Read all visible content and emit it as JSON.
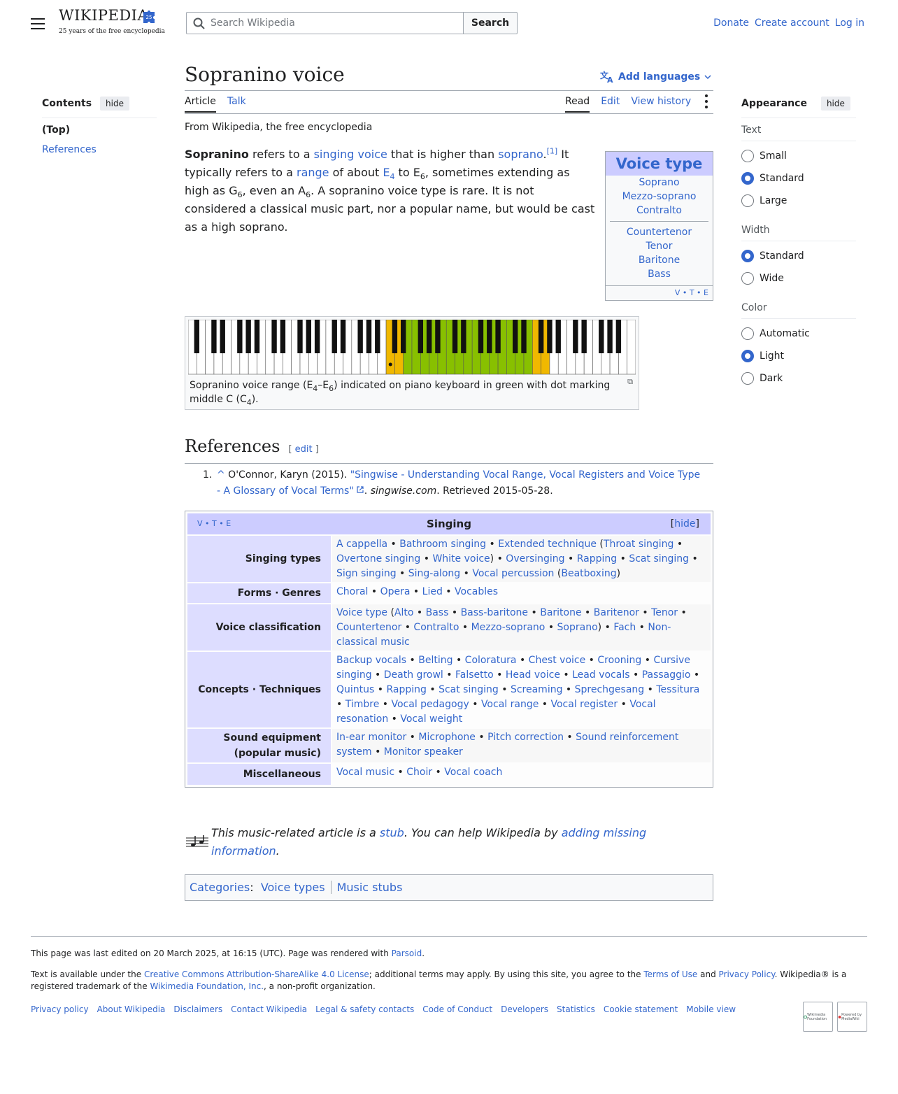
{
  "header": {
    "logo_word": "WIKIPEDIA",
    "logo_tagline": "25 years of the free encyclopedia",
    "search_placeholder": "Search Wikipedia",
    "search_button": "Search",
    "user_links": [
      "Donate",
      "Create account",
      "Log in"
    ]
  },
  "toc": {
    "title": "Contents",
    "hide": "hide",
    "items": [
      "(Top)",
      "References"
    ]
  },
  "page": {
    "title": "Sopranino voice",
    "add_languages": "Add languages",
    "tabs_left": [
      "Article",
      "Talk"
    ],
    "tabs_right": [
      "Read",
      "Edit",
      "View history"
    ],
    "from": "From Wikipedia, the free encyclopedia"
  },
  "lead": {
    "bold": "Sopranino",
    "t1": " refers to a ",
    "l1": "singing voice",
    "t2": " that is higher than ",
    "l2": "soprano",
    "t2b": ".",
    "cite": "[1]",
    "t3": " It typically refers to a ",
    "l3": "range",
    "t4": " of about ",
    "l4": "E",
    "l4sub": "4",
    "t5": " to E",
    "t5sub": "6",
    "t6": ", sometimes extending as high as G",
    "t6sub": "6",
    "t7": ", even an A",
    "t7sub": "6",
    "t8": ". A sopranino voice type is rare. It is not considered a classical music part, nor a popular name, but would be cast as a high soprano."
  },
  "voicebox": {
    "title": "Voice type",
    "female": [
      "Soprano",
      "Mezzo-soprano",
      "Contralto"
    ],
    "male": [
      "Countertenor",
      "Tenor",
      "Baritone",
      "Bass"
    ],
    "vte": "V • T • E"
  },
  "piano": {
    "caption_a": "Sopranino voice range (E",
    "caption_sub1": "4",
    "caption_b": "–E",
    "caption_sub2": "6",
    "caption_c": ") indicated on piano keyboard in green with dot marking middle C (C",
    "caption_sub3": "4",
    "caption_d": ").",
    "range_color": "#88c000",
    "extension_color": "#f0b800"
  },
  "references": {
    "heading": "References",
    "edit_open": "[ ",
    "edit": "edit",
    "edit_close": " ]",
    "items": [
      {
        "num": "1.",
        "caret": "^",
        "author": " O'Connor, Karyn (2015). ",
        "title": "\"Singwise - Understanding Vocal Range, Vocal Registers and Voice Type - A Glossary of Vocal Terms\"",
        "site": "singwise.com",
        "retrieved": ". Retrieved 2015-05-28."
      }
    ]
  },
  "navbox": {
    "vte": "V • T • E",
    "title": "Singing",
    "hide": "hide",
    "rows": [
      {
        "group": "Singing types",
        "list": "A cappella • Bathroom singing • Extended technique (Throat singing • Overtone singing • White voice) • Oversinging • Rapping • Scat singing • Sign singing • Sing-along • Vocal percussion (Beatboxing)"
      },
      {
        "group": "Forms · Genres",
        "list": "Choral • Opera • Lied • Vocables"
      },
      {
        "group": "Voice classification",
        "list": "Voice type (Alto • Bass • Bass-baritone • Baritone • Baritenor • Tenor • Countertenor • Contralto • Mezzo-soprano • Soprano) • Fach • Non-classical music"
      },
      {
        "group": "Concepts · Techniques",
        "list": "Backup vocals • Belting • Coloratura • Chest voice • Crooning • Cursive singing • Death growl • Falsetto • Head voice • Lead vocals • Passaggio • Quintus • Rapping • Scat singing • Screaming • Sprechgesang • Tessitura • Timbre • Vocal pedagogy • Vocal range • Vocal register • Vocal resonation • Vocal weight"
      },
      {
        "group": "Sound equipment (popular music)",
        "list": "In-ear monitor • Microphone • Pitch correction • Sound reinforcement system • Monitor speaker"
      },
      {
        "group": "Miscellaneous",
        "list": "Vocal music • Choir • Vocal coach"
      }
    ]
  },
  "stub": {
    "t1": "This music-related article is a ",
    "l1": "stub",
    "t2": ". You can help Wikipedia by ",
    "l2": "adding missing information",
    "t3": "."
  },
  "categories": {
    "label": "Categories",
    "colon": ":",
    "items": [
      "Voice types",
      "Music stubs"
    ]
  },
  "footer": {
    "edited_prefix": "This page was last edited on 20 March 2025, at 16:15 (UTC). Page was rendered with ",
    "parsoid": "Parsoid",
    "edited_suffix": ".",
    "lic1": "Text is available under the ",
    "lic_link": "Creative Commons Attribution-ShareAlike 4.0 License",
    "lic2": "; additional terms may apply. By using this site, you agree to the ",
    "terms": "Terms of Use",
    "lic3": " and ",
    "privacy": "Privacy Policy",
    "lic4": ". Wikipedia® is a registered trademark of the ",
    "wmf": "Wikimedia Foundation, Inc.",
    "lic5": ", a non-profit organization.",
    "links": [
      "Privacy policy",
      "About Wikipedia",
      "Disclaimers",
      "Contact Wikipedia",
      "Legal & safety contacts",
      "Code of Conduct",
      "Developers",
      "Statistics",
      "Cookie statement",
      "Mobile view"
    ],
    "badge1": "Wikimedia Foundation",
    "badge2": "Powered by MediaWiki"
  },
  "appearance": {
    "title": "Appearance",
    "hide": "hide",
    "text_label": "Text",
    "text_options": [
      "Small",
      "Standard",
      "Large"
    ],
    "text_selected": "Standard",
    "width_label": "Width",
    "width_options": [
      "Standard",
      "Wide"
    ],
    "width_selected": "Standard",
    "color_label": "Color",
    "color_options": [
      "Automatic",
      "Light",
      "Dark"
    ],
    "color_selected": "Light"
  }
}
